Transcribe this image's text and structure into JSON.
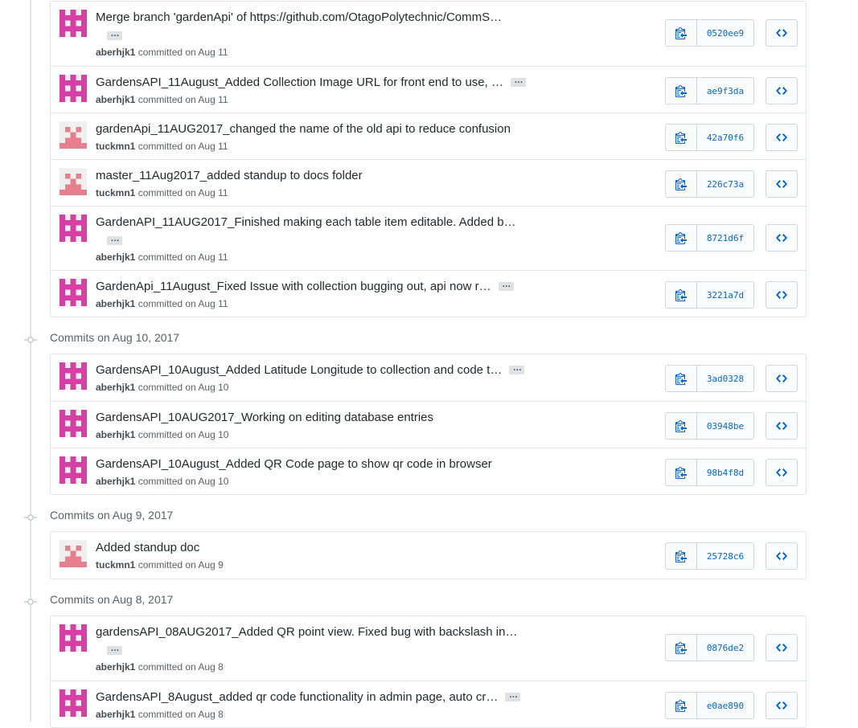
{
  "colors": {
    "accent_link": "#0366d6",
    "avatar_aberhjk1": "#d63fa3",
    "avatar_tuckmn1": "#e7808c",
    "border": "#e1e4e8"
  },
  "icons": {
    "copy": "clipboard-icon",
    "browse": "code-icon",
    "timeline": "git-commit-icon",
    "ellipsis": "ellipsis-icon"
  },
  "groups": [
    {
      "header": "",
      "commits": [
        {
          "message": "Merge branch 'gardenApi' of https://github.com/OtagoPolytechnic/CommS…",
          "ellipsis": "…",
          "ellipsis_wrapped": true,
          "author": "aberhjk1",
          "when": "committed on Aug 11",
          "sha": "0520ee9"
        },
        {
          "message": "GardensAPI_11August_Added Collection Image URL for front end to use, …",
          "ellipsis": "…",
          "ellipsis_wrapped": false,
          "author": "aberhjk1",
          "when": "committed on Aug 11",
          "sha": "ae9f3da"
        },
        {
          "message": "gardenApi_11AUG2017_changed the name of the old api to reduce confusion",
          "ellipsis": "",
          "ellipsis_wrapped": false,
          "author": "tuckmn1",
          "when": "committed on Aug 11",
          "sha": "42a70f6"
        },
        {
          "message": "master_11Aug2017_added standup to docs folder",
          "ellipsis": "",
          "ellipsis_wrapped": false,
          "author": "tuckmn1",
          "when": "committed on Aug 11",
          "sha": "226c73a"
        },
        {
          "message": "GardenAPI_11AUG2017_Finished making each table item editable. Added b…",
          "ellipsis": "…",
          "ellipsis_wrapped": true,
          "author": "aberhjk1",
          "when": "committed on Aug 11",
          "sha": "8721d6f"
        },
        {
          "message": "GardenApi_11August_Fixed Issue with collection bugging out, api now r…",
          "ellipsis": "…",
          "ellipsis_wrapped": false,
          "author": "aberhjk1",
          "when": "committed on Aug 11",
          "sha": "3221a7d"
        }
      ]
    },
    {
      "header": "Commits on Aug 10, 2017",
      "commits": [
        {
          "message": "GardensAPI_10August_Added Latitude Longitude to collection and code t…",
          "ellipsis": "…",
          "ellipsis_wrapped": false,
          "author": "aberhjk1",
          "when": "committed on Aug 10",
          "sha": "3ad0328"
        },
        {
          "message": "GardensAPI_10AUG2017_Working on editing database entries",
          "ellipsis": "",
          "ellipsis_wrapped": false,
          "author": "aberhjk1",
          "when": "committed on Aug 10",
          "sha": "03948be"
        },
        {
          "message": "GardensAPI_10August_Added QR Code page to show qr code in browser",
          "ellipsis": "",
          "ellipsis_wrapped": false,
          "author": "aberhjk1",
          "when": "committed on Aug 10",
          "sha": "98b4f8d"
        }
      ]
    },
    {
      "header": "Commits on Aug 9, 2017",
      "commits": [
        {
          "message": "Added standup doc",
          "ellipsis": "",
          "ellipsis_wrapped": false,
          "author": "tuckmn1",
          "when": "committed on Aug 9",
          "sha": "25728c6"
        }
      ]
    },
    {
      "header": "Commits on Aug 8, 2017",
      "commits": [
        {
          "message": "gardensAPI_08AUG2017_Added QR point view. Fixed bug with backslash in…",
          "ellipsis": "…",
          "ellipsis_wrapped": true,
          "author": "aberhjk1",
          "when": "committed on Aug 8",
          "sha": "0876de2"
        },
        {
          "message": "GardensAPI_8August_added qr code functionality in admin page, auto cr…",
          "ellipsis": "…",
          "ellipsis_wrapped": false,
          "author": "aberhjk1",
          "when": "committed on Aug 8",
          "sha": "e0ae890"
        }
      ]
    }
  ]
}
